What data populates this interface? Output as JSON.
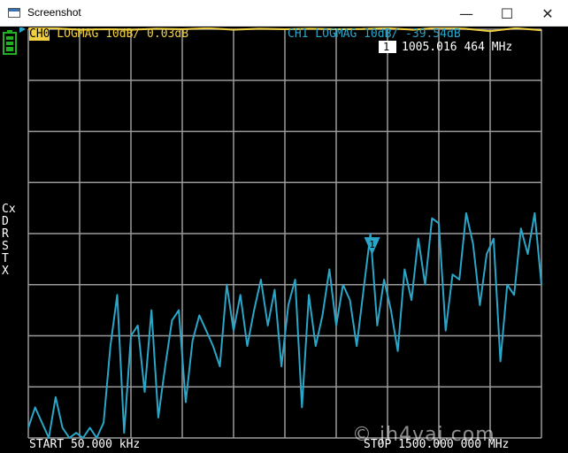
{
  "window": {
    "title": "Screenshot",
    "controls": {
      "minimize": "—",
      "maximize": "☐",
      "close": "✕"
    }
  },
  "header": {
    "ch0_chip": "CH0",
    "ch0_text": " LOGMAG 10dB/ 0.03dB",
    "ch1_text": "CH1 LOGMAG 10dB/ -39.54dB",
    "marker_number": "1",
    "marker_freq": "1005.016 464 MHz"
  },
  "footer": {
    "start": "START 50.000 kHz",
    "stop": "STOP 1500.000 000 MHz"
  },
  "side_menu": [
    "Cx",
    "D",
    "R",
    "S",
    "T",
    "X"
  ],
  "watermark": "© jh4vaj.com",
  "colors": {
    "ch0": "#f0d040",
    "ch1": "#2aa6c8",
    "grid": "#9a9a9a",
    "battery": "#22b022",
    "background": "#000000"
  },
  "chart_data": {
    "type": "line",
    "xlim": [
      0.05,
      1500
    ],
    "ylim": [
      -80,
      0
    ],
    "x_unit": "MHz",
    "y_unit": "dB",
    "grid": true,
    "marker": {
      "label": "1",
      "x": 1005.016464
    },
    "series": [
      {
        "name": "CH0",
        "x": [
          0.05,
          75,
          150,
          225,
          300,
          375,
          450,
          525,
          600,
          675,
          750,
          825,
          900,
          975,
          1050,
          1125,
          1200,
          1275,
          1350,
          1425,
          1500
        ],
        "y": [
          0.1,
          0.2,
          -0.1,
          0.0,
          -0.1,
          0.1,
          0.0,
          0.2,
          -0.1,
          0.1,
          0.0,
          0.1,
          0.0,
          0.03,
          0.2,
          -0.1,
          0.3,
          0.1,
          -0.4,
          0.2,
          -0.2
        ]
      },
      {
        "name": "CH1",
        "x": [
          0.05,
          20,
          40,
          60,
          80,
          100,
          120,
          140,
          160,
          180,
          200,
          220,
          240,
          260,
          280,
          300,
          320,
          340,
          360,
          380,
          400,
          420,
          440,
          460,
          480,
          500,
          520,
          540,
          560,
          580,
          600,
          620,
          640,
          660,
          680,
          700,
          720,
          740,
          760,
          780,
          800,
          820,
          840,
          860,
          880,
          900,
          920,
          940,
          960,
          980,
          1000,
          1020,
          1040,
          1060,
          1080,
          1100,
          1120,
          1140,
          1160,
          1180,
          1200,
          1220,
          1240,
          1260,
          1280,
          1300,
          1320,
          1340,
          1360,
          1380,
          1400,
          1420,
          1440,
          1460,
          1480,
          1500
        ],
        "y": [
          -78,
          -74,
          -77,
          -80,
          -72,
          -78,
          -80,
          -79,
          -80,
          -78,
          -80,
          -77,
          -62,
          -52,
          -79,
          -60,
          -58,
          -71,
          -55,
          -76,
          -66,
          -57,
          -55,
          -73,
          -61,
          -56,
          -59,
          -62,
          -66,
          -50,
          -59,
          -52,
          -62,
          -55,
          -49,
          -58,
          -51,
          -66,
          -54,
          -49,
          -74,
          -52,
          -62,
          -56,
          -47,
          -58,
          -50,
          -53,
          -62,
          -51,
          -40,
          -58,
          -49,
          -55,
          -63,
          -47,
          -53,
          -41,
          -50,
          -37,
          -38,
          -59,
          -48,
          -49,
          -36,
          -42,
          -54,
          -44,
          -41,
          -65,
          -50,
          -52,
          -39,
          -44,
          -36,
          -50
        ]
      }
    ]
  }
}
